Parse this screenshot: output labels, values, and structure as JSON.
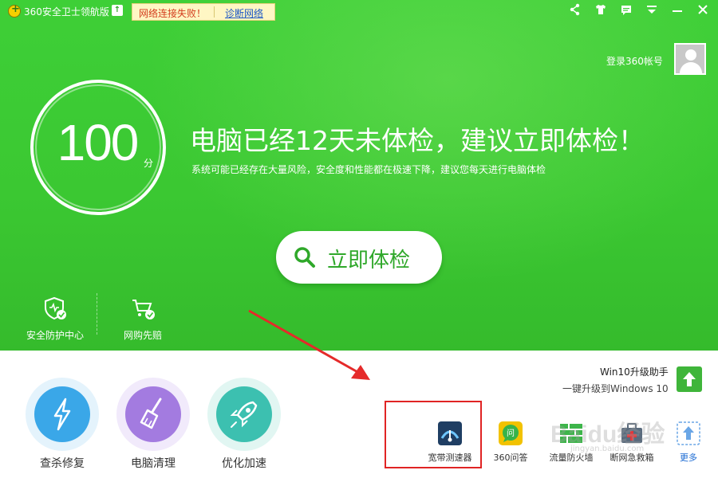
{
  "app": {
    "title": "360安全卫士领航版",
    "upgrade_icon": "upload-arrow-icon"
  },
  "network": {
    "message": "网络连接失败！",
    "diagnose_link": "诊断网络"
  },
  "window_controls": [
    "share-icon",
    "skin-icon",
    "feedback-icon",
    "menu-icon",
    "minimize-icon",
    "close-icon"
  ],
  "account": {
    "login_text": "登录360帐号",
    "avatar_icon": "user-avatar-icon"
  },
  "score": {
    "value": "100",
    "unit": "分"
  },
  "headline": "电脑已经12天未体检，建议立即体检！",
  "subline": "系统可能已经存在大量风险，安全度和性能都在极速下降，建议您每天进行电脑体检",
  "check_button": {
    "label": "立即体检",
    "icon": "search-icon"
  },
  "small_tools": [
    {
      "label": "安全防护中心",
      "icon": "shield-check-icon"
    },
    {
      "label": "网购先赔",
      "icon": "shopping-cart-check-icon"
    }
  ],
  "big_tools": [
    {
      "label": "查杀修复",
      "icon": "lightning-icon",
      "color": "#3aa7e8"
    },
    {
      "label": "电脑清理",
      "icon": "broom-icon",
      "color": "#a37be0"
    },
    {
      "label": "优化加速",
      "icon": "rocket-icon",
      "color": "#3cc0b0"
    }
  ],
  "win10": {
    "title": "Win10升级助手",
    "subtitle": "一键升级到Windows 10",
    "icon": "upgrade-arrow-icon"
  },
  "mini_tools": [
    {
      "label": "宽带测速器",
      "icon": "speedometer-icon"
    },
    {
      "label": "360问答",
      "icon": "qa-bubble-icon"
    },
    {
      "label": "流量防火墙",
      "icon": "firewall-icon"
    },
    {
      "label": "断网急救箱",
      "icon": "first-aid-icon"
    },
    {
      "label": "更多",
      "icon": "more-icon"
    }
  ],
  "watermark": {
    "text": "Baidu经验",
    "sub": "jingyan.baidu.com"
  },
  "colors": {
    "brand_green": "#3ecf37",
    "alert_red": "#e02424",
    "link_blue": "#1b56c6"
  }
}
